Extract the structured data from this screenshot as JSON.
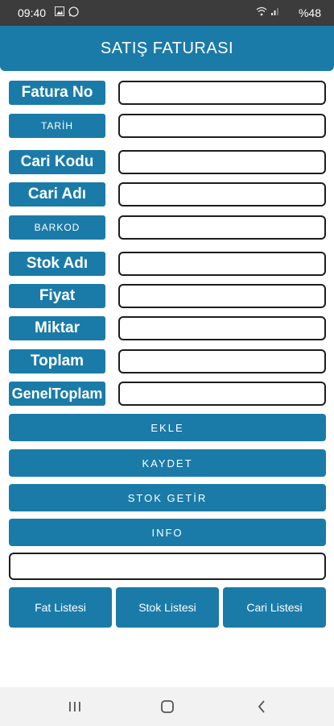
{
  "status_bar": {
    "time": "09:40",
    "battery": "%48",
    "icons": [
      "image-icon",
      "whatsapp-icon",
      "wifi-icon",
      "signal-icon"
    ]
  },
  "header": {
    "title": "SATIŞ FATURASI"
  },
  "form": {
    "fields": [
      {
        "label": "Fatura No",
        "value": ""
      },
      {
        "label": "TARİH",
        "value": ""
      },
      {
        "label": "Cari Kodu",
        "value": ""
      },
      {
        "label": "Cari Adı",
        "value": ""
      },
      {
        "label": "BARKOD",
        "value": ""
      },
      {
        "label": "Stok Adı",
        "value": ""
      },
      {
        "label": "Fiyat",
        "value": ""
      },
      {
        "label": "Miktar",
        "value": ""
      },
      {
        "label": "Toplam",
        "value": ""
      },
      {
        "label": "GenelToplam",
        "value": ""
      }
    ]
  },
  "actions": {
    "ekle": "EKLE",
    "kaydet": "KAYDET",
    "stok_getir": "STOK GETİR",
    "info": "INFO"
  },
  "info_field": {
    "value": ""
  },
  "list_buttons": {
    "fat_listesi": "Fat Listesi",
    "stok_listesi": "Stok Listesi",
    "cari_listesi": "Cari Listesi"
  },
  "colors": {
    "primary": "#1a7ba8",
    "status_bar": "#3c3c3c",
    "nav_bar": "#f2f2f2"
  }
}
